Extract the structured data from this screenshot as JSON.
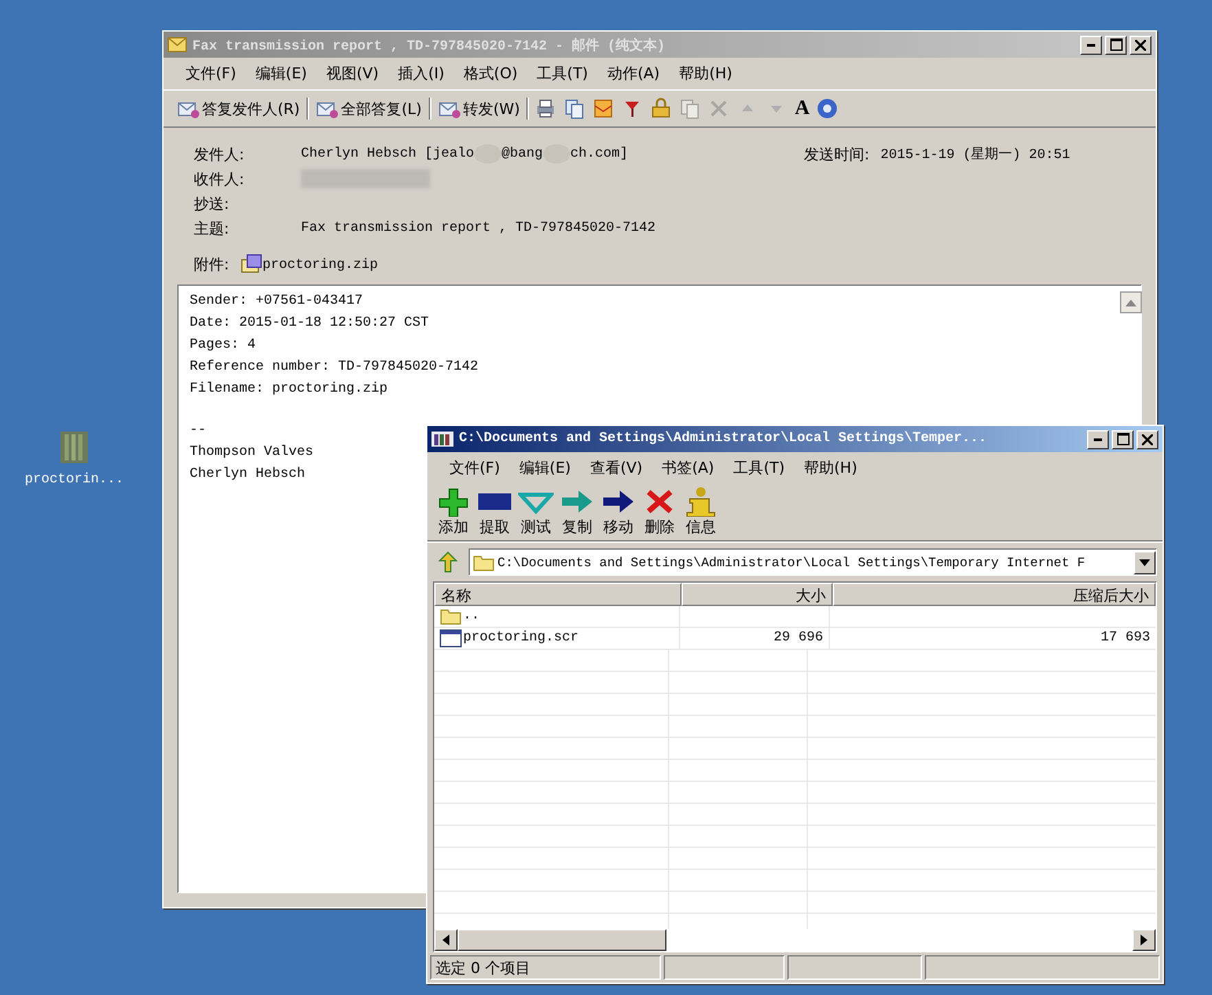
{
  "desktop_icons": [
    {
      "label": "proctorin..."
    }
  ],
  "mail_window": {
    "title": "Fax transmission report , TD-797845020-7142 - 邮件 (纯文本)",
    "menu": [
      "文件(F)",
      "编辑(E)",
      "视图(V)",
      "插入(I)",
      "格式(O)",
      "工具(T)",
      "动作(A)",
      "帮助(H)"
    ],
    "toolbar_buttons": [
      "答复发件人(R)",
      "全部答复(L)",
      "转发(W)"
    ],
    "font_glyph": "A",
    "header": {
      "from_label": "发件人:",
      "from": [
        "Cherlyn Hebsch [jealo",
        "@bang",
        "ch.com]"
      ],
      "sent_label": "发送时间:",
      "sent": "2015-1-19 (星期一) 20:51",
      "to_label": "收件人:",
      "cc_label": "抄送:",
      "subject_label": "主题:",
      "subject": "Fax transmission report , TD-797845020-7142",
      "attach_label": "附件:",
      "attachment": "proctoring.zip"
    },
    "body": [
      [
        "Sender: +07561-043417",
        "Date: 2015-01-18 12:50:27 CST",
        "Pages: 4",
        "Reference number: TD-797845020-7142",
        "Filename: proctoring.zip"
      ],
      [
        "--",
        "Thompson Valves",
        "Cherlyn Hebsch"
      ]
    ]
  },
  "archive_window": {
    "title": "C:\\Documents and Settings\\Administrator\\Local Settings\\Temper...",
    "menu": [
      "文件(F)",
      "编辑(E)",
      "查看(V)",
      "书签(A)",
      "工具(T)",
      "帮助(H)"
    ],
    "tools": [
      "添加",
      "提取",
      "测试",
      "复制",
      "移动",
      "删除",
      "信息"
    ],
    "path": "C:\\Documents and Settings\\Administrator\\Local Settings\\Temporary Internet F",
    "columns": [
      "名称",
      "大小",
      "压缩后大小"
    ],
    "rows": [
      {
        "kind": "parent",
        "name": ".."
      },
      {
        "kind": "file",
        "name": "proctoring.scr",
        "size": "29 696",
        "packed": "17 693"
      }
    ],
    "status": "选定 0 个项目"
  }
}
